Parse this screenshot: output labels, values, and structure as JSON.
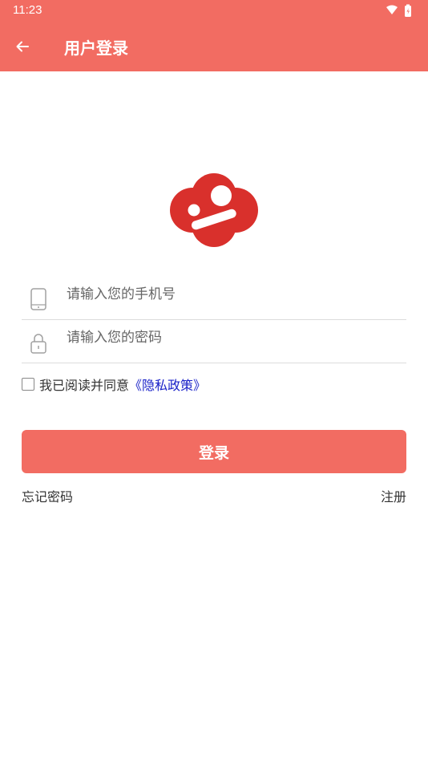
{
  "status_bar": {
    "time": "11:23"
  },
  "header": {
    "title": "用户登录"
  },
  "form": {
    "phone_placeholder": "请输入您的手机号",
    "password_placeholder": "请输入您的密码",
    "agree_text": "我已阅读并同意",
    "privacy_link": "《隐私政策》",
    "agree_checked": false
  },
  "actions": {
    "login_label": "登录",
    "forgot_label": "忘记密码",
    "register_label": "注册"
  },
  "colors": {
    "primary": "#f26c62",
    "logo": "#d9302c",
    "link": "#1a22c8"
  },
  "icons": [
    "back-arrow-icon",
    "wifi-icon",
    "battery-icon",
    "phone-icon",
    "lock-icon"
  ]
}
